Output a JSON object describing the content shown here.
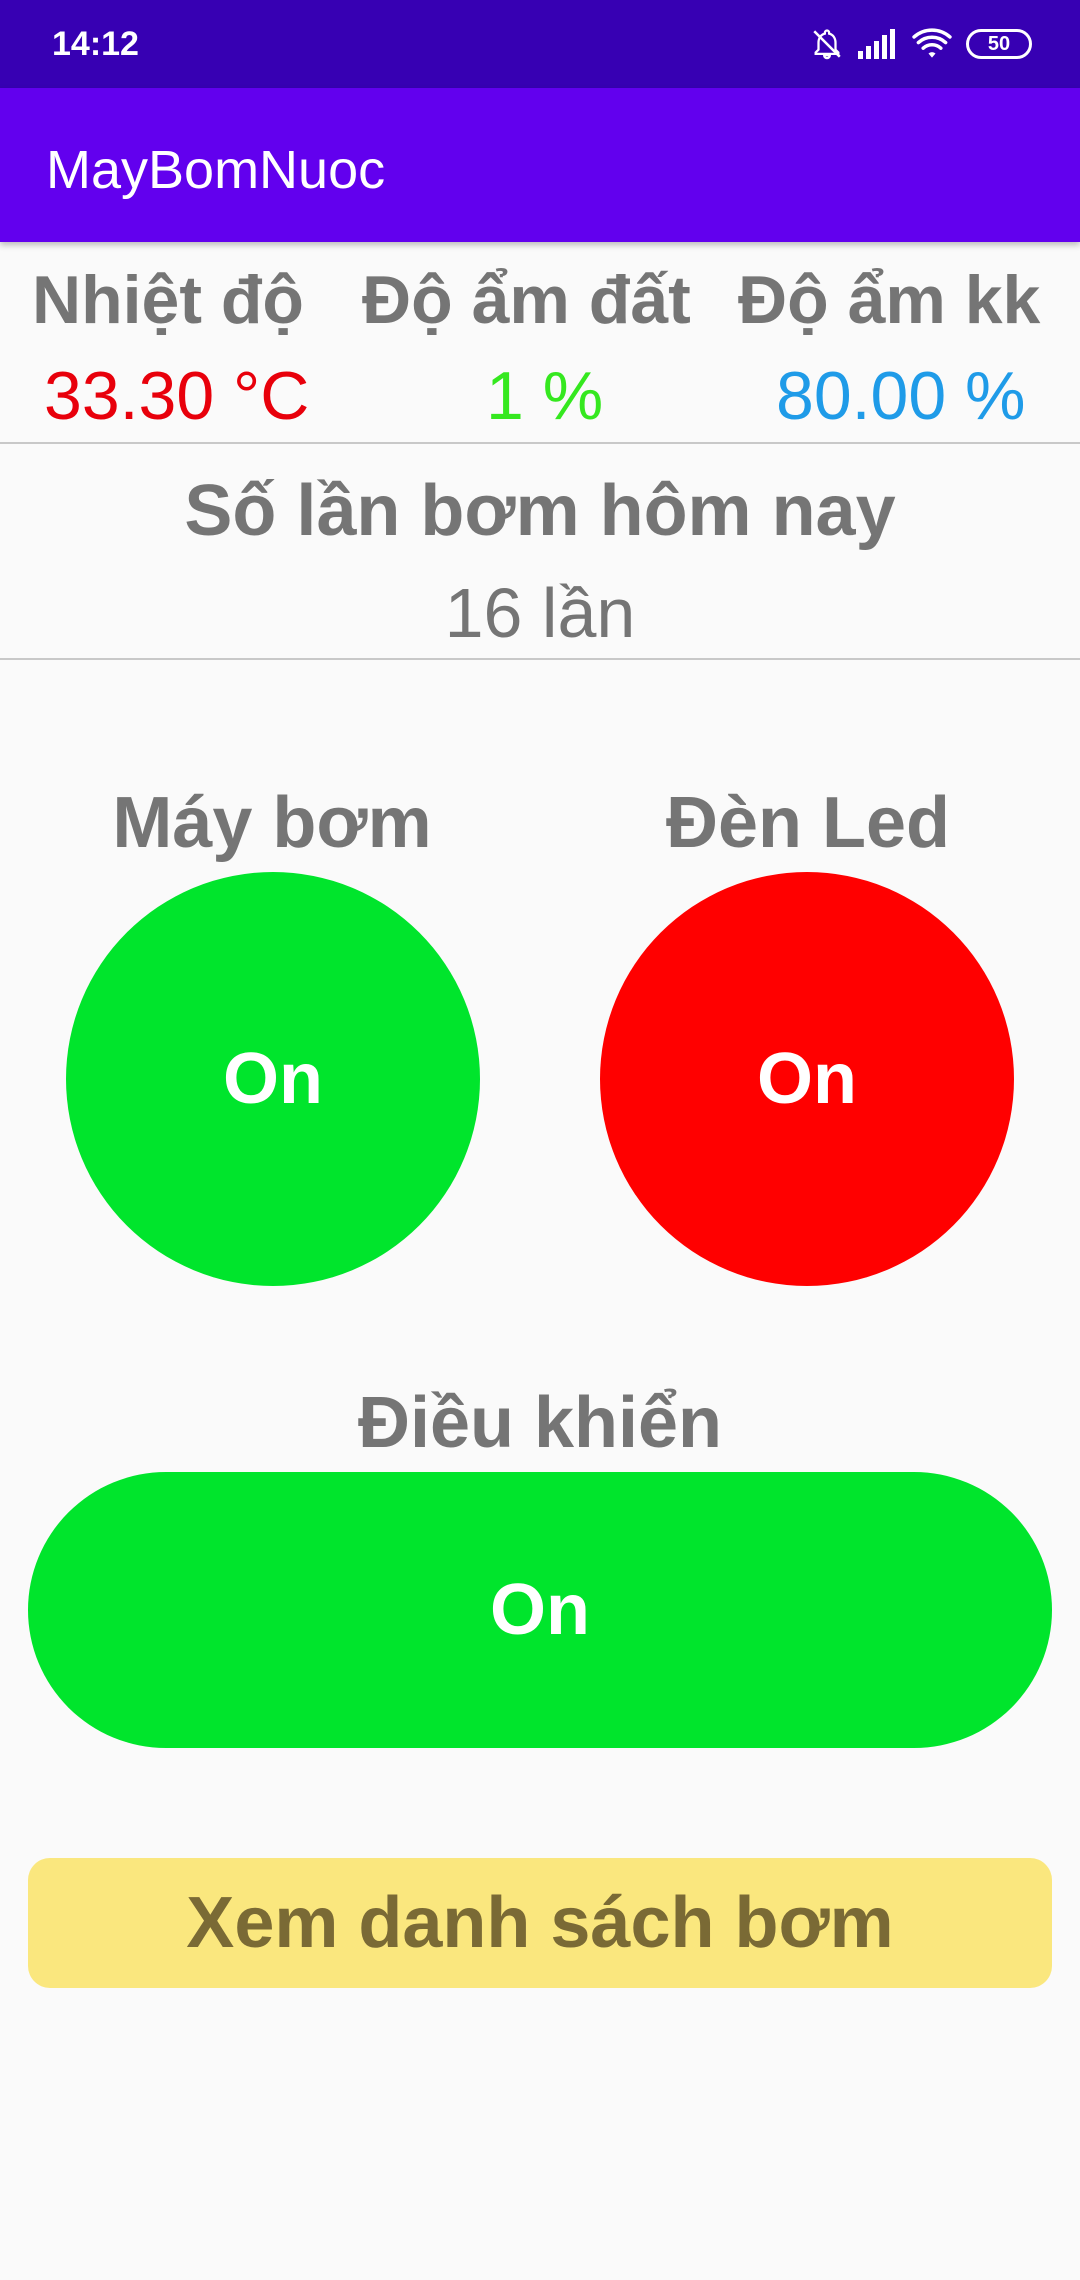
{
  "status_bar": {
    "time": "14:12",
    "battery": "50",
    "icons": [
      "bell-off-icon",
      "signal-icon",
      "wifi-icon",
      "battery-icon"
    ]
  },
  "app_bar": {
    "title": "MayBomNuoc"
  },
  "sensors": [
    {
      "label": "Nhiệt độ",
      "value": "33.30 °C",
      "color": "#e8000b"
    },
    {
      "label": "Độ ẩm đất",
      "value": "1 %",
      "color": "#35e81f"
    },
    {
      "label": "Độ ẩm kk",
      "value": "80.00 %",
      "color": "#1f9be8"
    }
  ],
  "pump_count": {
    "label": "Số lần bơm hôm nay",
    "value": "16 lần"
  },
  "devices": [
    {
      "label": "Máy bơm",
      "state": "On",
      "color": "#00e52c"
    },
    {
      "label": "Đèn Led",
      "state": "On",
      "color": "#ff0000"
    }
  ],
  "control": {
    "label": "Điều khiển",
    "state": "On",
    "color": "#00e52c"
  },
  "list_button": {
    "label": "Xem danh sách bơm",
    "background": "#fae77e",
    "text_color": "#7a6a35"
  }
}
